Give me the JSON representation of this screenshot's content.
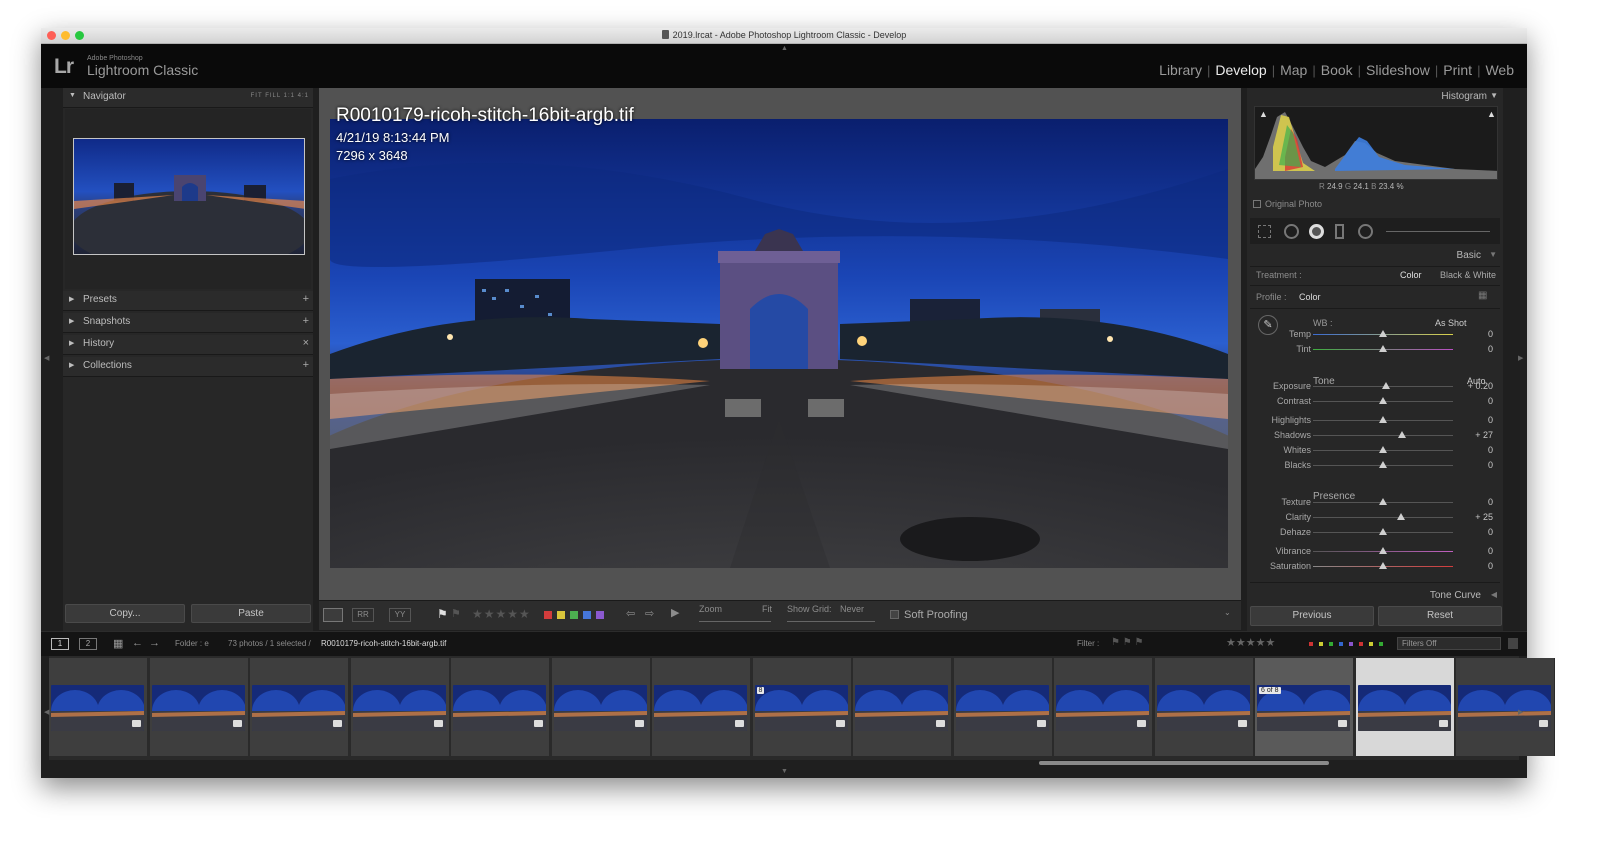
{
  "window": {
    "title": "2019.lrcat - Adobe Photoshop Lightroom Classic - Develop",
    "traffic_colors": [
      "#fe5f57",
      "#febc2e",
      "#28c840"
    ]
  },
  "header": {
    "logo": "Lr",
    "brand_small": "Adobe Photoshop",
    "brand_name": "Lightroom Classic",
    "modules": [
      {
        "label": "Library",
        "active": false
      },
      {
        "label": "Develop",
        "active": true
      },
      {
        "label": "Map",
        "active": false
      },
      {
        "label": "Book",
        "active": false
      },
      {
        "label": "Slideshow",
        "active": false
      },
      {
        "label": "Print",
        "active": false
      },
      {
        "label": "Web",
        "active": false
      }
    ]
  },
  "left": {
    "navigator": "Navigator",
    "zoom_options": "FIT  FILL  1:1  4:1",
    "panels": [
      {
        "label": "Presets",
        "action": "+"
      },
      {
        "label": "Snapshots",
        "action": "+"
      },
      {
        "label": "History",
        "action": "×"
      },
      {
        "label": "Collections",
        "action": "+"
      }
    ],
    "copy": "Copy...",
    "paste": "Paste"
  },
  "image": {
    "filename": "R0010179-ricoh-stitch-16bit-argb.tif",
    "date": "4/21/19 8:13:44 PM",
    "dimensions": "7296 x 3648"
  },
  "toolbar": {
    "zoom": "Zoom",
    "fit": "Fit",
    "show_grid": "Show Grid:",
    "never": "Never",
    "soft_proofing": "Soft Proofing"
  },
  "right": {
    "histogram": "Histogram",
    "rgb": {
      "r_label": "R",
      "r": "24.9",
      "g_label": "G",
      "g": "24.1",
      "b_label": "B",
      "b": "23.4",
      "unit": "%"
    },
    "original_photo": "Original Photo",
    "basic": "Basic",
    "treatment_label": "Treatment :",
    "treatment_color": "Color",
    "treatment_bw": "Black & White",
    "profile_label": "Profile :",
    "profile_value": "Color",
    "wb_label": "WB :",
    "wb_value": "As Shot",
    "tone": "Tone",
    "auto": "Auto",
    "presence": "Presence",
    "tone_curve": "Tone Curve",
    "previous": "Previous",
    "reset": "Reset",
    "sliders": [
      {
        "label": "Temp",
        "value": "0",
        "pos": 0.5
      },
      {
        "label": "Tint",
        "value": "0",
        "pos": 0.5
      },
      {
        "label": "Exposure",
        "value": "+ 0.20",
        "pos": 0.52
      },
      {
        "label": "Contrast",
        "value": "0",
        "pos": 0.5
      },
      {
        "label": "Highlights",
        "value": "0",
        "pos": 0.5
      },
      {
        "label": "Shadows",
        "value": "+ 27",
        "pos": 0.635
      },
      {
        "label": "Whites",
        "value": "0",
        "pos": 0.5
      },
      {
        "label": "Blacks",
        "value": "0",
        "pos": 0.5
      },
      {
        "label": "Texture",
        "value": "0",
        "pos": 0.5
      },
      {
        "label": "Clarity",
        "value": "+ 25",
        "pos": 0.625
      },
      {
        "label": "Dehaze",
        "value": "0",
        "pos": 0.5
      },
      {
        "label": "Vibrance",
        "value": "0",
        "pos": 0.5
      },
      {
        "label": "Saturation",
        "value": "0",
        "pos": 0.5
      }
    ]
  },
  "filmstrip": {
    "view1": "1",
    "view2": "2",
    "folder_label": "Folder : e",
    "count": "73 photos / 1 selected /",
    "current_file": "R0010179-ricoh-stitch-16bit-argb.tif",
    "filter_label": "Filter :",
    "filters_off": "Filters Off",
    "thumbs": [
      {
        "badge": "",
        "state": "normal"
      },
      {
        "badge": "",
        "state": "normal"
      },
      {
        "badge": "",
        "state": "normal"
      },
      {
        "badge": "",
        "state": "normal"
      },
      {
        "badge": "",
        "state": "normal"
      },
      {
        "badge": "",
        "state": "normal"
      },
      {
        "badge": "",
        "state": "normal"
      },
      {
        "badge": "8",
        "state": "normal"
      },
      {
        "badge": "",
        "state": "normal"
      },
      {
        "badge": "",
        "state": "normal"
      },
      {
        "badge": "",
        "state": "normal"
      },
      {
        "badge": "",
        "state": "normal"
      },
      {
        "badge": "6 of 8",
        "state": "cur"
      },
      {
        "badge": "",
        "state": "sel"
      },
      {
        "badge": "",
        "state": "normal"
      }
    ]
  }
}
